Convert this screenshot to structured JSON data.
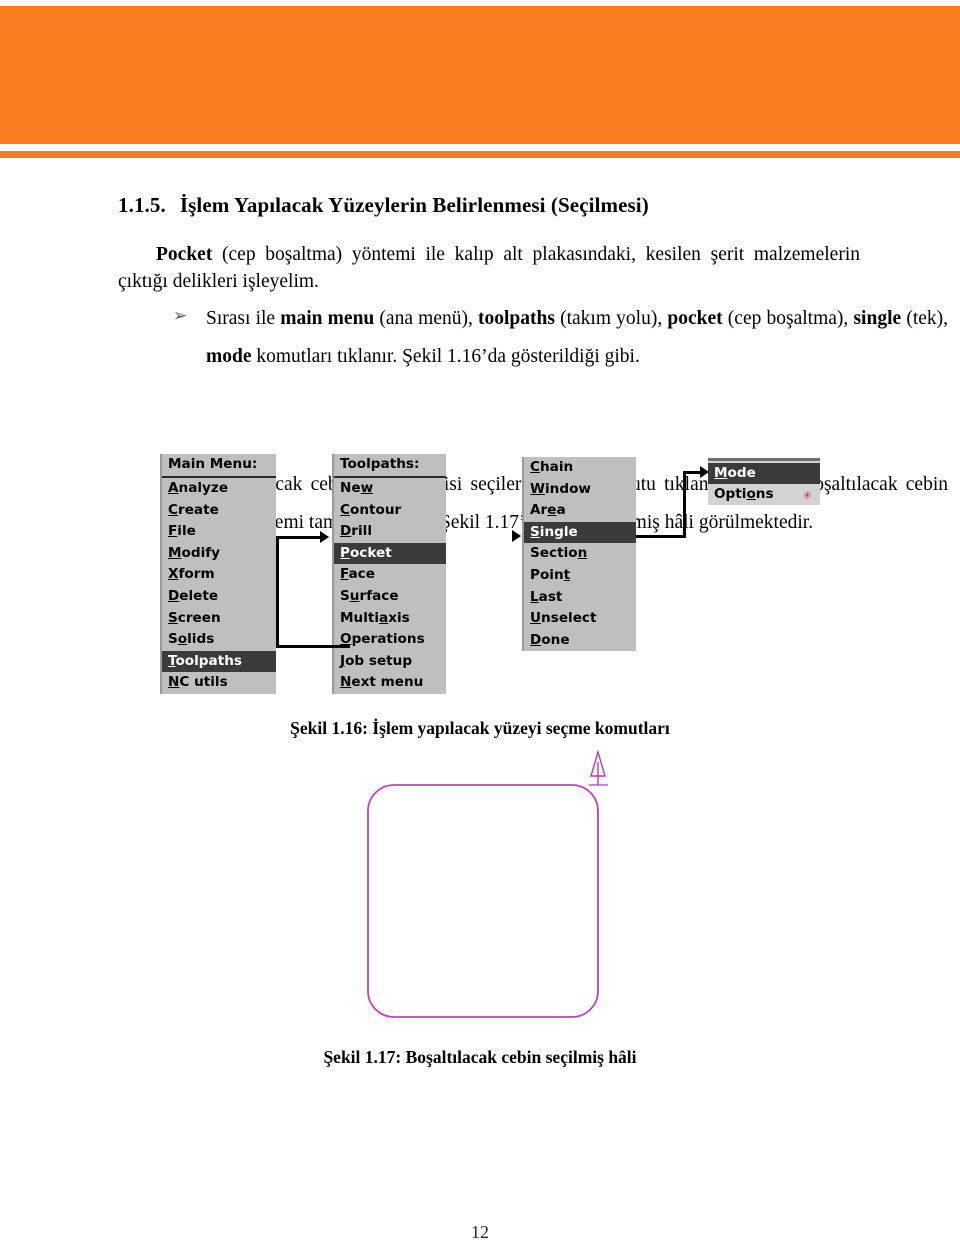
{
  "header": {
    "band_color": "#f97c1e",
    "rule_color": "#f97c1e"
  },
  "section": {
    "number": "1.1.5.",
    "title": "İşlem Yapılacak Yüzeylerin Belirlenmesi (Seçilmesi)"
  },
  "paragraphs": {
    "intro_bold": "Pocket",
    "intro_rest": "(cep boşaltma)  yöntemi ile kalıp alt plakasındaki, kesilen şerit malzemelerin çıktığı delikleri işleyelim."
  },
  "bullets": [
    {
      "marker": "➢",
      "parts": [
        {
          "text": "Sırası ile ",
          "bold": false
        },
        {
          "text": "main menu",
          "bold": true
        },
        {
          "text": " (ana menü), ",
          "bold": false
        },
        {
          "text": "toolpaths",
          "bold": true
        },
        {
          "text": " (takım yolu), ",
          "bold": false
        },
        {
          "text": "pocket",
          "bold": true
        },
        {
          "text": " (cep boşaltma), ",
          "bold": false
        },
        {
          "text": "single",
          "bold": true
        },
        {
          "text": " (tek), ",
          "bold": false
        },
        {
          "text": "mode",
          "bold": true
        },
        {
          "text": " komutları tıklanır. Şekil 1.16’da gösterildiği gibi.",
          "bold": false
        }
      ]
    },
    {
      "marker": "➢",
      "parts": [
        {
          "text": "Boşaltılacak cebin çevre çizgisi seçilerek ",
          "bold": false
        },
        {
          "text": "done",
          "bold": true
        },
        {
          "text": " komutu tıklanır. Böylece boşaltılacak cebin seçim işlemi tamamlanmıştır. Şekil 1.17’de cebin seçilmiş hâli görülmektedir.",
          "bold": false
        }
      ]
    }
  ],
  "menu_figure": {
    "panels": [
      {
        "id": "main",
        "title": "Main Menu:",
        "title_accel": "",
        "items": [
          {
            "label": "Analyze",
            "accel_index": 0,
            "selected": false
          },
          {
            "label": "Create",
            "accel_index": 0,
            "selected": false
          },
          {
            "label": "File",
            "accel_index": 0,
            "selected": false
          },
          {
            "label": "Modify",
            "accel_index": 0,
            "selected": false
          },
          {
            "label": "Xform",
            "accel_index": 0,
            "selected": false
          },
          {
            "label": "Delete",
            "accel_index": 0,
            "selected": false
          },
          {
            "label": "Screen",
            "accel_index": 0,
            "selected": false
          },
          {
            "label": "Solids",
            "accel_index": 1,
            "selected": false
          },
          {
            "label": "Toolpaths",
            "accel_index": 0,
            "selected": true
          },
          {
            "label": "NC utils",
            "accel_index": 0,
            "selected": false
          }
        ]
      },
      {
        "id": "toolpaths",
        "title": "Toolpaths:",
        "items": [
          {
            "label": "New",
            "accel_index": 2,
            "selected": false
          },
          {
            "label": "Contour",
            "accel_index": 0,
            "selected": false
          },
          {
            "label": "Drill",
            "accel_index": 0,
            "selected": false
          },
          {
            "label": "Pocket",
            "accel_index": 0,
            "selected": true
          },
          {
            "label": "Face",
            "accel_index": 0,
            "selected": false
          },
          {
            "label": "Surface",
            "accel_index": 1,
            "selected": false
          },
          {
            "label": "Multiaxis",
            "accel_index": 5,
            "selected": false
          },
          {
            "label": "Operations",
            "accel_index": 0,
            "selected": false
          },
          {
            "label": "Job setup",
            "accel_index": 0,
            "selected": false
          },
          {
            "label": "Next menu",
            "accel_index": 0,
            "selected": false
          }
        ]
      },
      {
        "id": "chain",
        "title": "",
        "items": [
          {
            "label": "Chain",
            "accel_index": 0,
            "selected": false
          },
          {
            "label": "Window",
            "accel_index": 0,
            "selected": false
          },
          {
            "label": "Area",
            "accel_index": 2,
            "selected": false
          },
          {
            "label": "Single",
            "accel_index": 0,
            "selected": true
          },
          {
            "label": "Section",
            "accel_index": 6,
            "selected": false
          },
          {
            "label": "Point",
            "accel_index": 4,
            "selected": false
          },
          {
            "label": "Last",
            "accel_index": 0,
            "selected": false
          },
          {
            "label": "Unselect",
            "accel_index": 0,
            "selected": false
          },
          {
            "label": "Done",
            "accel_index": 0,
            "selected": false
          }
        ]
      },
      {
        "id": "mode",
        "title": "",
        "items": [
          {
            "label": "Mode",
            "accel_index": 0,
            "selected": true,
            "star": ""
          },
          {
            "label": "Options",
            "accel_index": 4,
            "selected": false,
            "star": "✳"
          }
        ]
      }
    ]
  },
  "captions": {
    "figure_1_16": "Şekil 1.16: İşlem yapılacak yüzeyi seçme komutları",
    "figure_1_17": "Şekil 1.17: Boşaltılacak cebin seçilmiş hâli"
  },
  "pocket_figure": {
    "outline_color": "#c040c0",
    "arrow_color": "#b83ab8"
  },
  "page_number": "12"
}
